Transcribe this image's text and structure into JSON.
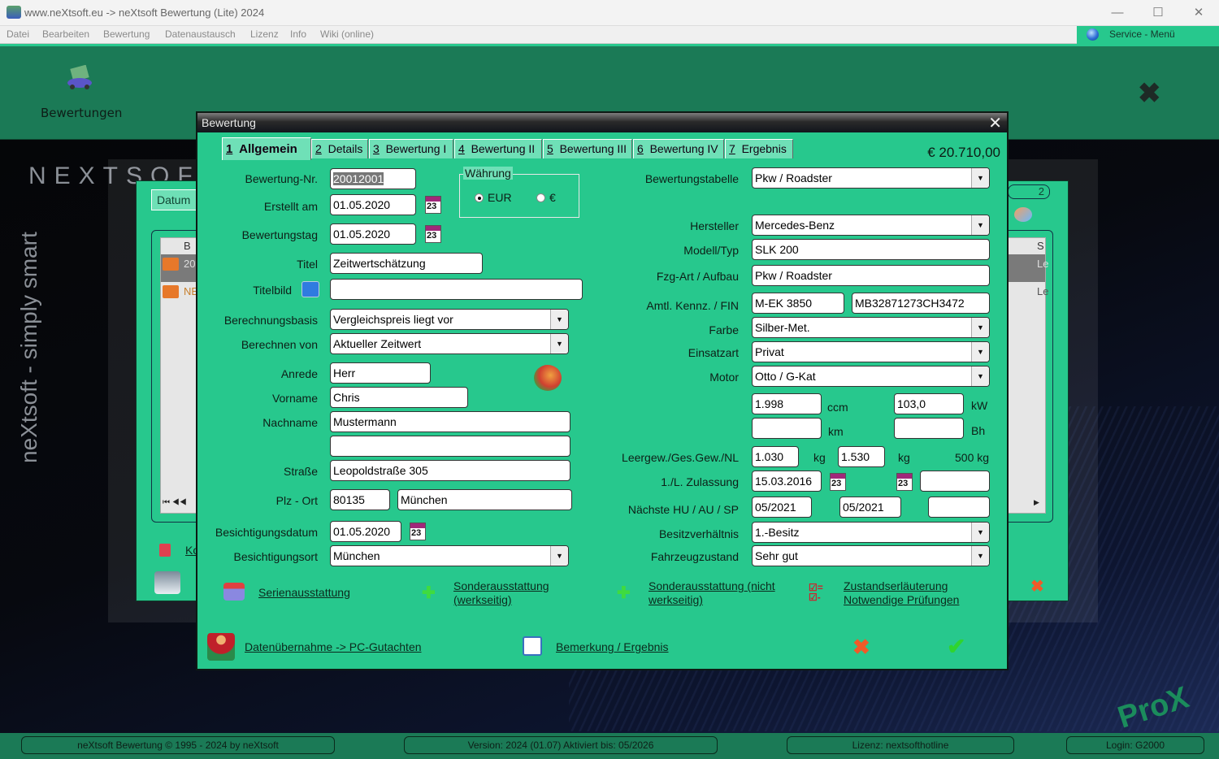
{
  "window": {
    "title": "www.neXtsoft.eu -> neXtsoft Bewertung (Lite) 2024",
    "controls": [
      "minimize",
      "maximize",
      "close"
    ]
  },
  "menu": [
    "Datei",
    "Bearbeiten",
    "Bewertung",
    "Datenaustausch",
    "Lizenz",
    "Info",
    "Wiki (online)"
  ],
  "service_menu": "Service - Menü",
  "toolbar": {
    "bewertungen_label": "Bewertungen"
  },
  "background": {
    "brand": "NEXTSOFT",
    "tagline": "neXtsoft - simply smart",
    "logo": "ProX"
  },
  "back_window": {
    "datum_tab": "Datum",
    "page_number": "2",
    "row1": "20",
    "row2": "NE",
    "col_b": "B",
    "col_s": "S",
    "link_partial": "Ko",
    "le1": "Le",
    "le2": "Le"
  },
  "dialog": {
    "title": "Bewertung",
    "price": "€ 20.710,00",
    "tabs": [
      {
        "num": "1",
        "label": "Allgemein",
        "active": true
      },
      {
        "num": "2",
        "label": "Details"
      },
      {
        "num": "3",
        "label": "Bewertung I"
      },
      {
        "num": "4",
        "label": "Bewertung II"
      },
      {
        "num": "5",
        "label": "Bewertung III"
      },
      {
        "num": "6",
        "label": "Bewertung IV"
      },
      {
        "num": "7",
        "label": "Ergebnis"
      }
    ],
    "left": {
      "bewertung_nr": {
        "label": "Bewertung-Nr.",
        "value": "20012001"
      },
      "erstellt_am": {
        "label": "Erstellt am",
        "value": "01.05.2020"
      },
      "bewertungstag": {
        "label": "Bewertungstag",
        "value": "01.05.2020"
      },
      "titel": {
        "label": "Titel",
        "value": "Zeitwertschätzung"
      },
      "titelbild": {
        "label": "Titelbild",
        "value": ""
      },
      "berechnungsbasis": {
        "label": "Berechnungsbasis",
        "value": "Vergleichspreis liegt vor"
      },
      "berechnen_von": {
        "label": "Berechnen von",
        "value": "Aktueller Zeitwert"
      },
      "anrede": {
        "label": "Anrede",
        "value": "Herr"
      },
      "vorname": {
        "label": "Vorname",
        "value": "Chris"
      },
      "nachname": {
        "label": "Nachname",
        "value": "Mustermann"
      },
      "zusatz": {
        "value": ""
      },
      "strasse": {
        "label": "Straße",
        "value": "Leopoldstraße 305"
      },
      "plz_ort": {
        "label": "Plz - Ort",
        "plz": "80135",
        "ort": "München"
      },
      "besichtigungsdatum": {
        "label": "Besichtigungsdatum",
        "value": "01.05.2020"
      },
      "besichtigungsort": {
        "label": "Besichtigungsort",
        "value": "München"
      }
    },
    "waehrung": {
      "legend": "Währung",
      "options": [
        "EUR",
        "€"
      ],
      "selected": "EUR"
    },
    "right": {
      "bewertungstabelle": {
        "label": "Bewertungstabelle",
        "value": "Pkw / Roadster"
      },
      "hersteller": {
        "label": "Hersteller",
        "value": "Mercedes-Benz"
      },
      "modell": {
        "label": "Modell/Typ",
        "value": "SLK 200"
      },
      "fzg_art": {
        "label": "Fzg-Art / Aufbau",
        "value": "Pkw / Roadster"
      },
      "kennz_fin": {
        "label": "Amtl. Kennz. / FIN",
        "kennz": "M-EK 3850",
        "fin": "MB32871273CH3472"
      },
      "farbe": {
        "label": "Farbe",
        "value": "Silber-Met."
      },
      "einsatzart": {
        "label": "Einsatzart",
        "value": "Privat"
      },
      "motor": {
        "label": "Motor",
        "value": "Otto / G-Kat"
      },
      "ccm": {
        "value": "1.998",
        "unit": "ccm"
      },
      "kw": {
        "value": "103,0",
        "unit": "kW"
      },
      "km": {
        "value": "",
        "unit": "km"
      },
      "bh": {
        "value": "",
        "unit": "Bh"
      },
      "gewicht": {
        "label": "Leergew./Ges.Gew./NL",
        "leer": "1.030",
        "ges": "1.530",
        "unit": "kg",
        "nl": "500 kg"
      },
      "zulassung": {
        "label": "1./L. Zulassung",
        "erst": "15.03.2016",
        "letzte": ""
      },
      "hu_au_sp": {
        "label": "Nächste HU / AU / SP",
        "hu": "05/2021",
        "au": "05/2021",
        "sp": ""
      },
      "besitz": {
        "label": "Besitzverhältnis",
        "value": "1.-Besitz"
      },
      "zustand": {
        "label": "Fahrzeugzustand",
        "value": "Sehr gut"
      }
    },
    "links": {
      "serien": "Serienausstattung",
      "sonder_werk_1": "Sonderausstattung",
      "sonder_werk_2": "(werkseitig)",
      "sonder_nicht_1": "Sonderausstattung (nicht",
      "sonder_nicht_2": "werkseitig)",
      "zustand_1": "Zustandserläuterung",
      "zustand_2": "Notwendige Prüfungen",
      "daten": "Datenübernahme -> PC-Gutachten",
      "bemerkung": "Bemerkung / Ergebnis"
    }
  },
  "statusbar": {
    "copyright": "neXtsoft Bewertung     © 1995 - 2024 by neXtsoft",
    "version": "Version: 2024   (01.07)    Aktiviert bis: 05/2026",
    "lizenz": "Lizenz: nextsofthotline",
    "login": "Login: G2000"
  }
}
